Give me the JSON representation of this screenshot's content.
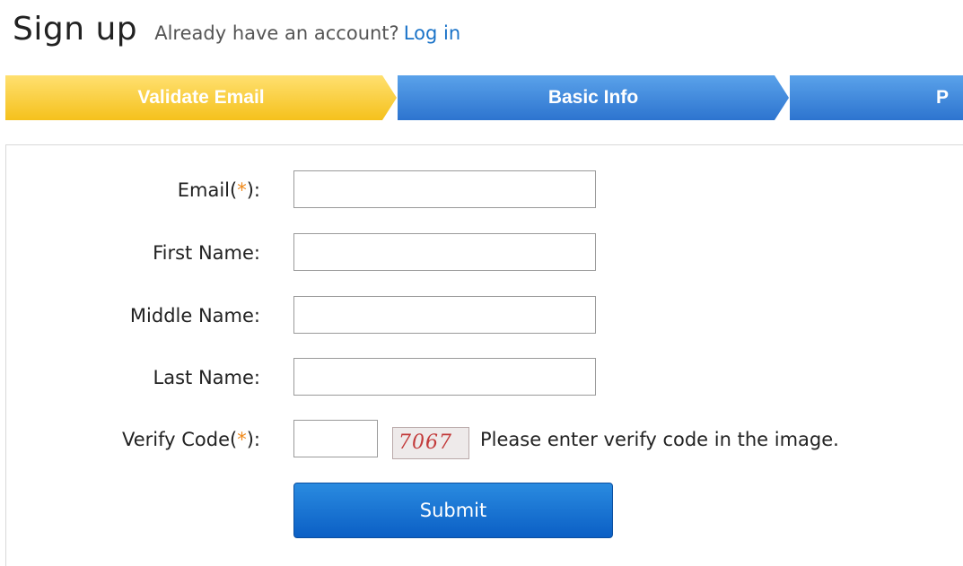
{
  "header": {
    "title": "Sign up",
    "subtitle": "Already have an account?",
    "login_link": "Log in"
  },
  "steps": [
    {
      "label": "Validate Email",
      "active": true,
      "color": "#f5c11c"
    },
    {
      "label": "Basic Info",
      "active": false,
      "color": "#2d74cf"
    },
    {
      "label": "P",
      "active": false,
      "color": "#2d74cf"
    }
  ],
  "form": {
    "fields": [
      {
        "label": "Email",
        "required": true,
        "value": ""
      },
      {
        "label": "First Name:",
        "required": false,
        "value": ""
      },
      {
        "label": "Middle Name:",
        "required": false,
        "value": ""
      },
      {
        "label": "Last Name:",
        "required": false,
        "value": ""
      },
      {
        "label": "Verify Code",
        "required": true,
        "value": ""
      }
    ],
    "required_mark": "*",
    "label_open": "(",
    "label_close": "):",
    "captcha_text": "7067",
    "captcha_hint": "Please enter verify code in the image.",
    "submit_label": "Submit"
  },
  "colors": {
    "link": "#1a73c8",
    "required": "#f08a1c",
    "active_step": "#f5c11c",
    "inactive_step": "#2d74cf",
    "submit": "#0b5fc5"
  }
}
